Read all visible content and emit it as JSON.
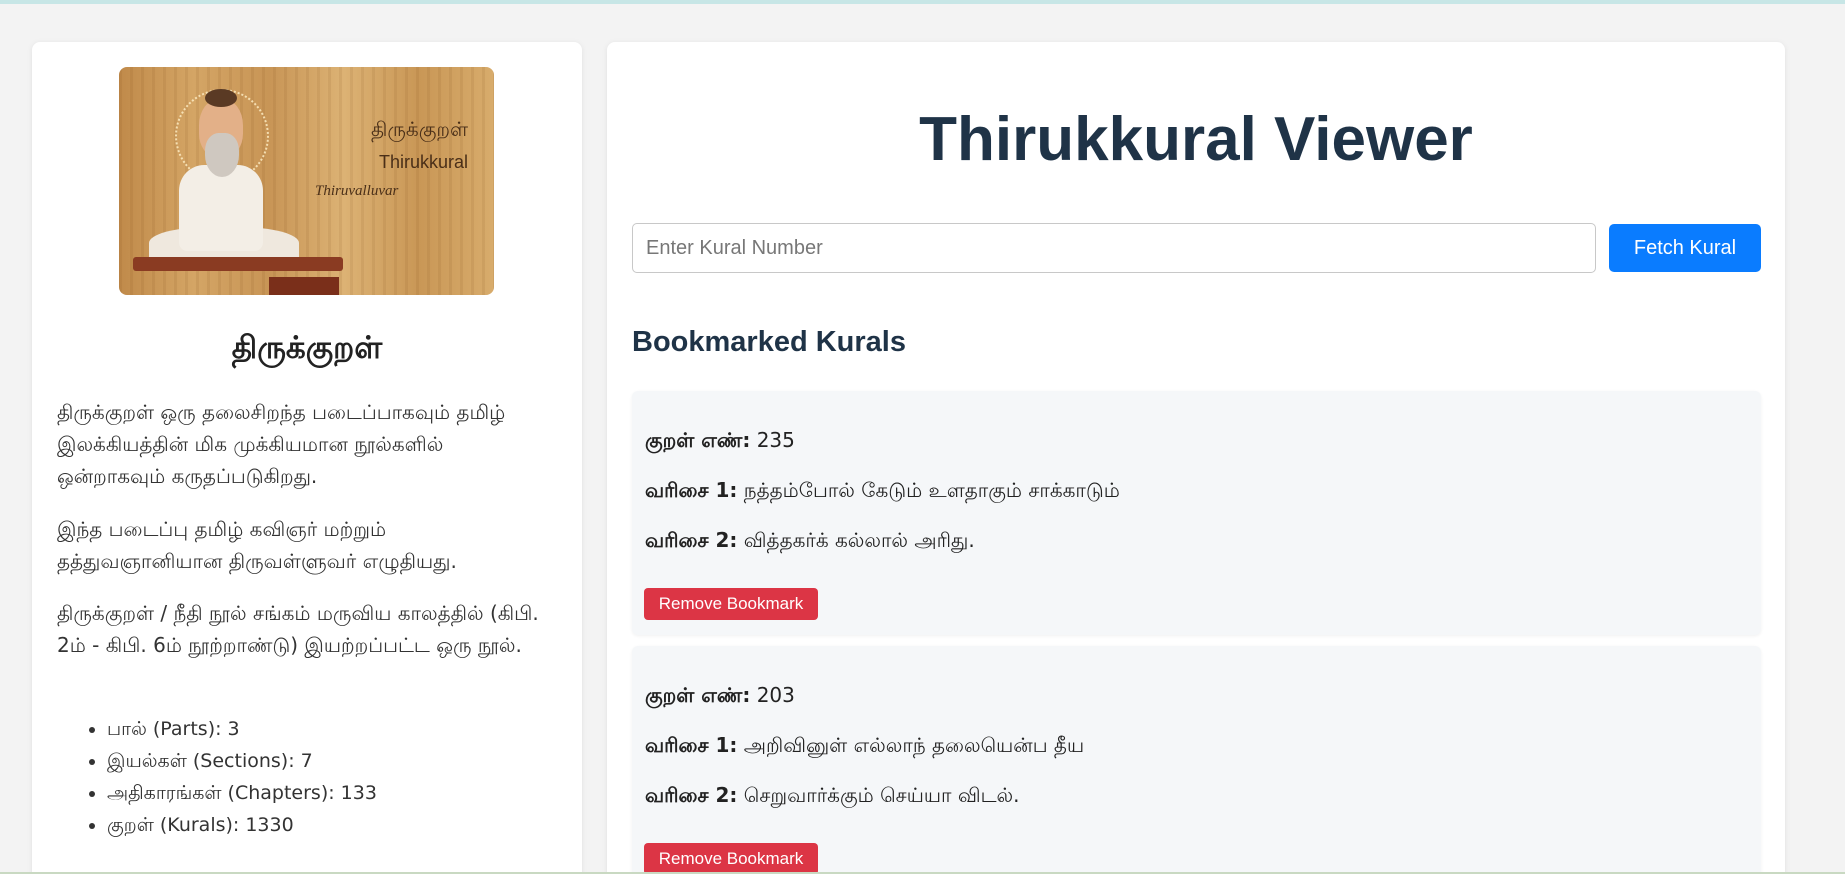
{
  "hero": {
    "image_label_tamil": "திருக்குறள்",
    "image_label_english": "Thirukkural",
    "image_signature": "Thiruvalluvar"
  },
  "sidebar": {
    "title": "திருக்குறள்",
    "paragraphs": [
      "திருக்குறள் ஒரு தலைசிறந்த படைப்பாகவும் தமிழ் இலக்கியத்தின் மிக முக்கியமான நூல்களில் ஒன்றாகவும் கருதப்படுகிறது.",
      "இந்த படைப்பு தமிழ் கவிஞர் மற்றும் தத்துவஞானியான திருவள்ளுவர் எழுதியது.",
      "திருக்குறள் / நீதி நூல் சங்கம் மருவிய காலத்தில் (கிபி. 2ம் - கிபி. 6ம் நூற்றாண்டு) இயற்றப்பட்ட ஒரு நூல்."
    ],
    "facts": [
      "பால் (Parts): 3",
      "இயல்கள் (Sections): 7",
      "அதிகாரங்கள் (Chapters): 133",
      "குறள் (Kurals): 1330"
    ]
  },
  "main": {
    "title": "Thirukkural Viewer",
    "search_placeholder": "Enter Kural Number",
    "search_value": "",
    "fetch_label": "Fetch Kural",
    "bookmarks_title": "Bookmarked Kurals",
    "bookmark_labels": {
      "number": "குறள் எண்:",
      "line1": "வரிசை 1:",
      "line2": "வரிசை 2:"
    },
    "remove_label": "Remove Bookmark",
    "bookmarks": [
      {
        "number": "235",
        "line1": "நத்தம்போல் கேடும் உளதாகும் சாக்காடும்",
        "line2": "வித்தகர்க் கல்லால் அரிது."
      },
      {
        "number": "203",
        "line1": "அறிவினுள் எல்லாந் தலையென்ப தீய",
        "line2": "செறுவார்க்கும் செய்யா விடல்."
      }
    ]
  }
}
